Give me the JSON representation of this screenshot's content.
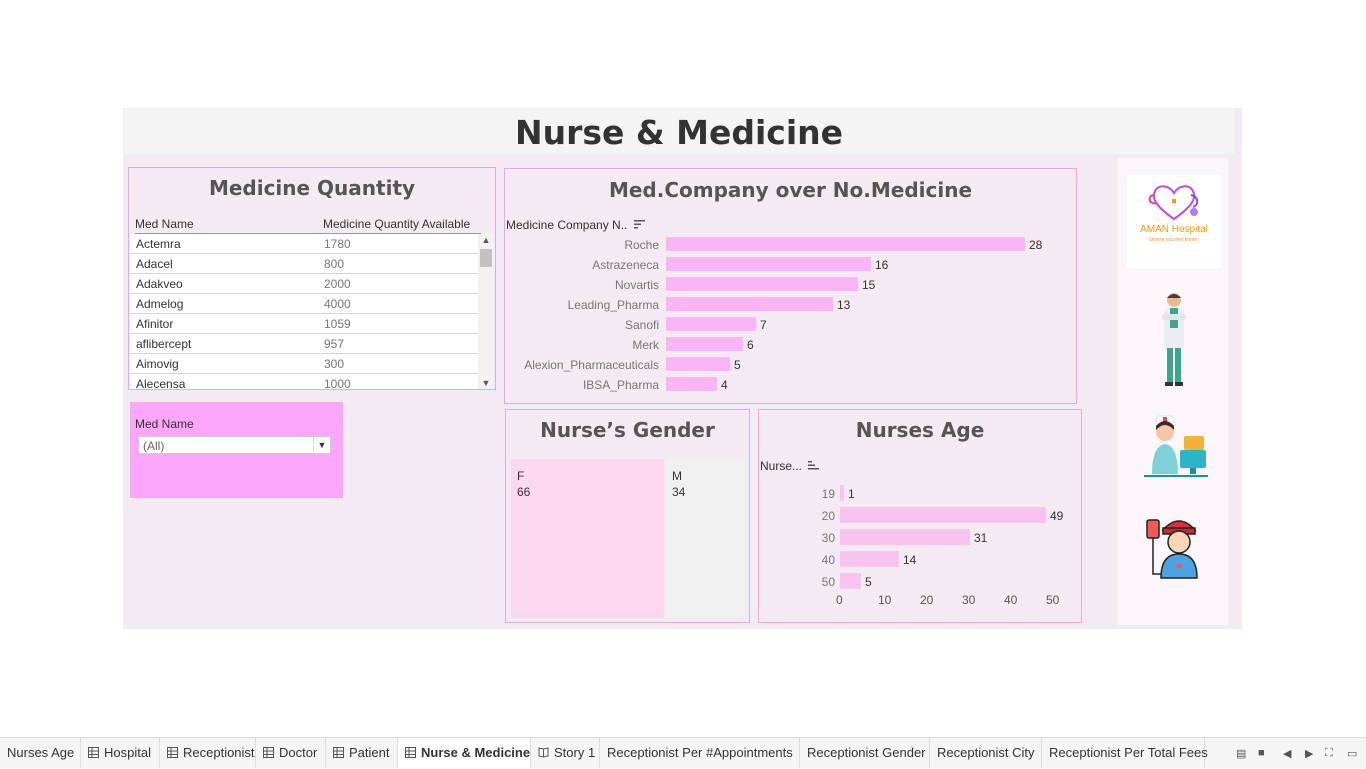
{
  "dashboard": {
    "title": "Nurse & Medicine"
  },
  "medicine_quantity": {
    "title": "Medicine Quantity",
    "col_name": "Med Name",
    "col_qty": "Medicine Quantity Available",
    "rows": [
      {
        "name": "Actemra",
        "qty": "1780"
      },
      {
        "name": "Adacel",
        "qty": "800"
      },
      {
        "name": "Adakveo",
        "qty": "2000"
      },
      {
        "name": "Admelog",
        "qty": "4000"
      },
      {
        "name": "Afinitor",
        "qty": "1059"
      },
      {
        "name": "aflibercept",
        "qty": "957"
      },
      {
        "name": "Aimovig",
        "qty": "300"
      },
      {
        "name": "Alecensa",
        "qty": "1000"
      }
    ]
  },
  "filter": {
    "label": "Med Name",
    "value": "(All)"
  },
  "med_company": {
    "title": "Med.Company over No.Medicine",
    "header": "Medicine Company N..",
    "bar_color": "#fbb5f4",
    "max": 28,
    "rows": [
      {
        "label": "Roche",
        "value": 28
      },
      {
        "label": "Astrazeneca",
        "value": 16
      },
      {
        "label": "Novartis",
        "value": 15
      },
      {
        "label": "Leading_Pharma",
        "value": 13
      },
      {
        "label": "Sanofi",
        "value": 7
      },
      {
        "label": "Merk",
        "value": 6
      },
      {
        "label": "Alexion_Pharmaceuticals",
        "value": 5
      },
      {
        "label": "IBSA_Pharma",
        "value": 4
      }
    ]
  },
  "nurse_gender": {
    "title": "Nurse’s Gender",
    "cells": [
      {
        "label": "F",
        "value": "66",
        "color": "#fbd8ef"
      },
      {
        "label": "M",
        "value": "34",
        "color": "#f0f0f0"
      }
    ]
  },
  "nurses_age": {
    "title": "Nurses Age",
    "header": "Nurse...",
    "bar_color": "#f6c4ee",
    "axis_max": 50,
    "ticks": [
      "0",
      "10",
      "20",
      "30",
      "40",
      "50"
    ],
    "rows": [
      {
        "label": "19",
        "value": 1
      },
      {
        "label": "20",
        "value": 49
      },
      {
        "label": "30",
        "value": 31
      },
      {
        "label": "40",
        "value": 14
      },
      {
        "label": "50",
        "value": 5
      }
    ]
  },
  "logo": {
    "name": "AMAN Hospital",
    "tagline": "(where you feel home)"
  },
  "tabs": [
    {
      "label": "Nurses Age",
      "icon": "none",
      "active": false
    },
    {
      "label": "Hospital",
      "icon": "grid",
      "active": false
    },
    {
      "label": "Receptionist",
      "icon": "grid",
      "active": false
    },
    {
      "label": "Doctor",
      "icon": "grid",
      "active": false
    },
    {
      "label": "Patient",
      "icon": "grid",
      "active": false
    },
    {
      "label": "Nurse & Medicine",
      "icon": "grid",
      "active": true
    },
    {
      "label": "Story 1",
      "icon": "book",
      "active": false
    },
    {
      "label": "Receptionist Per #Appointments",
      "icon": "none",
      "active": false
    },
    {
      "label": "Receptionist Gender",
      "icon": "none",
      "active": false
    },
    {
      "label": "Receptionist City",
      "icon": "none",
      "active": false
    },
    {
      "label": "Receptionist Per Total Fees",
      "icon": "none",
      "active": false
    }
  ]
}
